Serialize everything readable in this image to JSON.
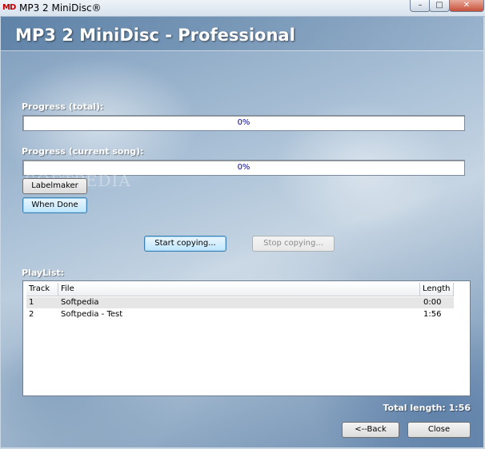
{
  "window": {
    "title": "MP3 2 MiniDisc®",
    "icon_text": "MD",
    "controls": {
      "minimize": "–",
      "maximize": "□",
      "close": "✕"
    }
  },
  "header": {
    "app_title": "MP3 2 MiniDisc - Professional"
  },
  "progress_total": {
    "label": "Progress (total):",
    "text": "0%",
    "fraction": 0
  },
  "progress_song": {
    "label": "Progress (current song):",
    "text": "0%",
    "fraction": 0
  },
  "watermark": "SOFTPEDIA",
  "buttons": {
    "labelmaker": "Labelmaker",
    "when_done": "When Done",
    "start_copying": "Start copying...",
    "stop_copying": "Stop copying...",
    "back": "<--Back",
    "close": "Close"
  },
  "playlist": {
    "label": "PlayList:",
    "columns": [
      "Track",
      "File",
      "Length"
    ],
    "rows": [
      {
        "track": "1",
        "file": "Softpedia",
        "length": "0:00"
      },
      {
        "track": "2",
        "file": "Softpedia - Test",
        "length": "1:56"
      }
    ]
  },
  "total_length": "Total length: 1:56",
  "colors": {
    "progress_text": "#0000a0",
    "heading": "#ffffff"
  }
}
